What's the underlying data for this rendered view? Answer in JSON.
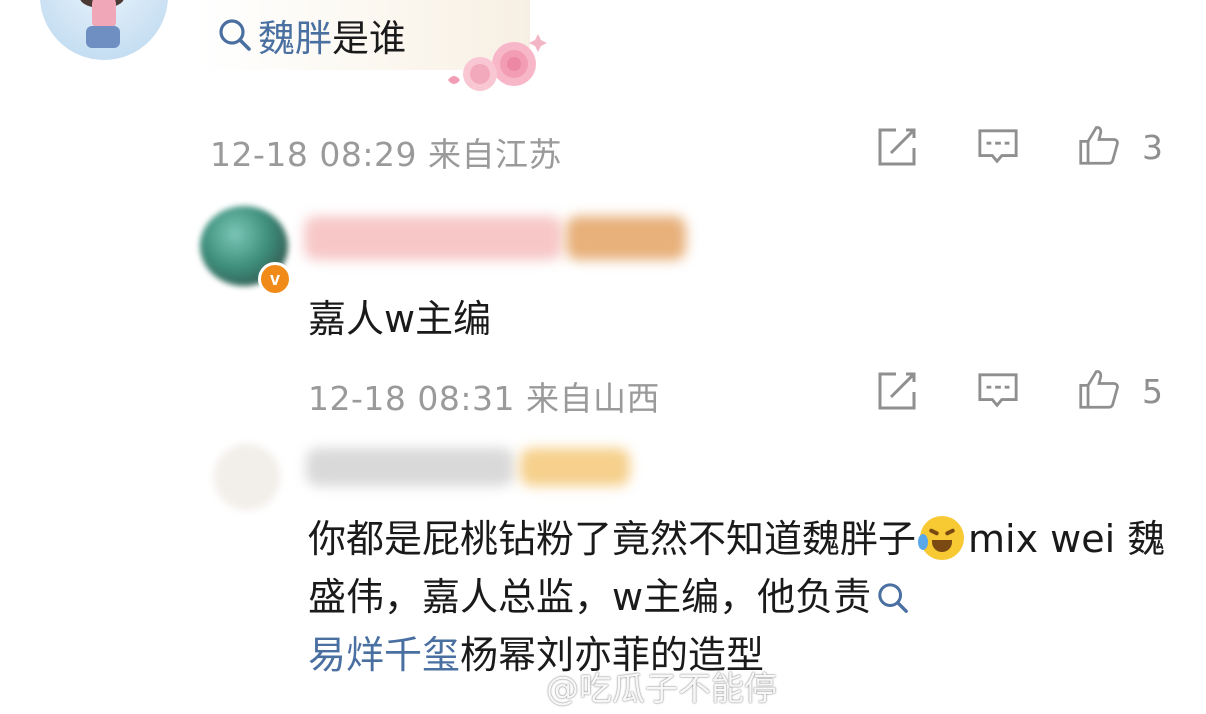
{
  "comment1": {
    "search_link": "魏胖",
    "search_suffix": "是谁",
    "timestamp": "12-18 08:29",
    "location": "来自江苏",
    "likes": "3"
  },
  "reply1": {
    "username": "",
    "text": "嘉人w主编",
    "timestamp": "12-18 08:31",
    "location": "来自山西",
    "likes": "5",
    "badge": "v"
  },
  "reply2": {
    "username": "",
    "text_part1": "你都是屁桃钻粉了竟然不知道魏胖子",
    "text_part2": "mix wei 魏盛伟，嘉人总监，w主编，他负责",
    "search_link": "易烊千玺",
    "text_part3": "杨幂刘亦菲的造型"
  },
  "watermark": {
    "text": "@吃瓜子不能停"
  },
  "icons": {
    "search": "search-icon",
    "share": "share-icon",
    "comment": "comment-icon",
    "like": "thumbs-up-icon",
    "emoji": "laughing-crying-emoji-icon"
  },
  "colors": {
    "link": "#4a6fa1",
    "meta": "#9a9a9a",
    "verified": "#f08b1a"
  }
}
